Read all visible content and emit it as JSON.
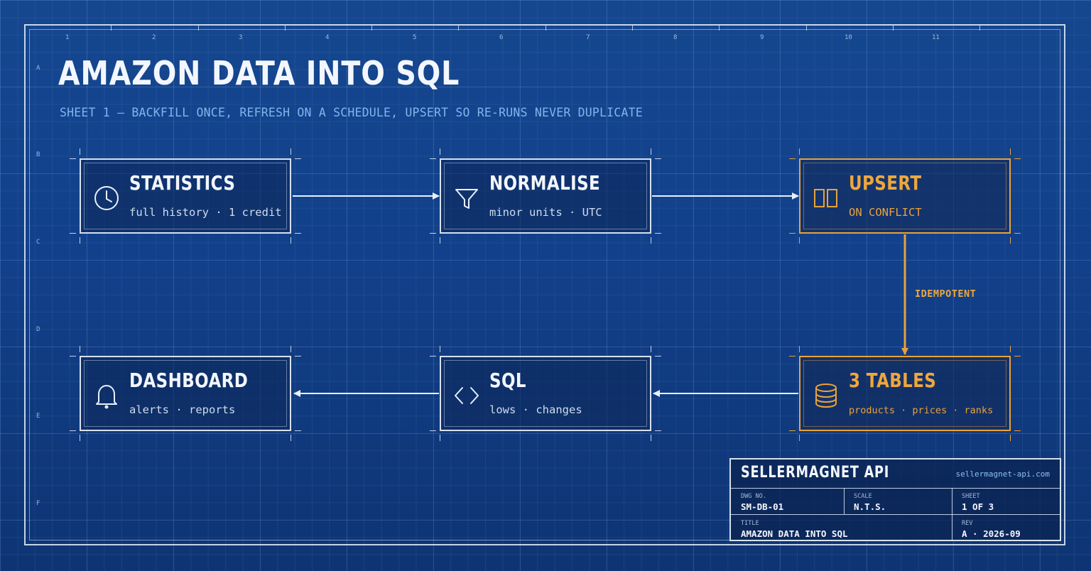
{
  "grid": {
    "columns": [
      "1",
      "2",
      "3",
      "4",
      "5",
      "6",
      "7",
      "8",
      "9",
      "10",
      "11"
    ],
    "rows": [
      "A",
      "B",
      "C",
      "D",
      "E",
      "F"
    ]
  },
  "title": "AMAZON DATA INTO SQL",
  "subtitle": "SHEET 1  —  BACKFILL ONCE, REFRESH ON A SCHEDULE, UPSERT SO RE-RUNS NEVER DUPLICATE",
  "nodes": {
    "statistics": {
      "title": "STATISTICS",
      "subtitle": "full history · 1 credit",
      "icon": "clock-icon"
    },
    "normalise": {
      "title": "NORMALISE",
      "subtitle": "minor units · UTC",
      "icon": "filter-icon"
    },
    "upsert": {
      "title": "UPSERT",
      "subtitle": "ON CONFLICT",
      "icon": "upsert-icon"
    },
    "tables": {
      "title": "3 TABLES",
      "subtitle": "products · prices · ranks",
      "icon": "database-icon"
    },
    "sql": {
      "title": "SQL",
      "subtitle": "lows · changes",
      "icon": "code-icon"
    },
    "dashboard": {
      "title": "DASHBOARD",
      "subtitle": "alerts · reports",
      "icon": "bell-icon"
    }
  },
  "edges": {
    "upsert_to_tables_label": "IDEMPOTENT"
  },
  "colors": {
    "background": "#12408a",
    "line": "#e8f0fa",
    "accent": "#e9a23b",
    "subtitle": "#7fb6ec"
  },
  "title_block": {
    "brand": "SELLERMAGNET API",
    "url": "sellermagnet-api.com",
    "dwg_no_label": "DWG NO.",
    "dwg_no": "SM-DB-01",
    "scale_label": "SCALE",
    "scale": "N.T.S.",
    "sheet_label": "SHEET",
    "sheet": "1 OF 3",
    "title_label": "TITLE",
    "title": "AMAZON DATA INTO SQL",
    "rev_label": "REV",
    "rev": "A · 2026-09"
  }
}
